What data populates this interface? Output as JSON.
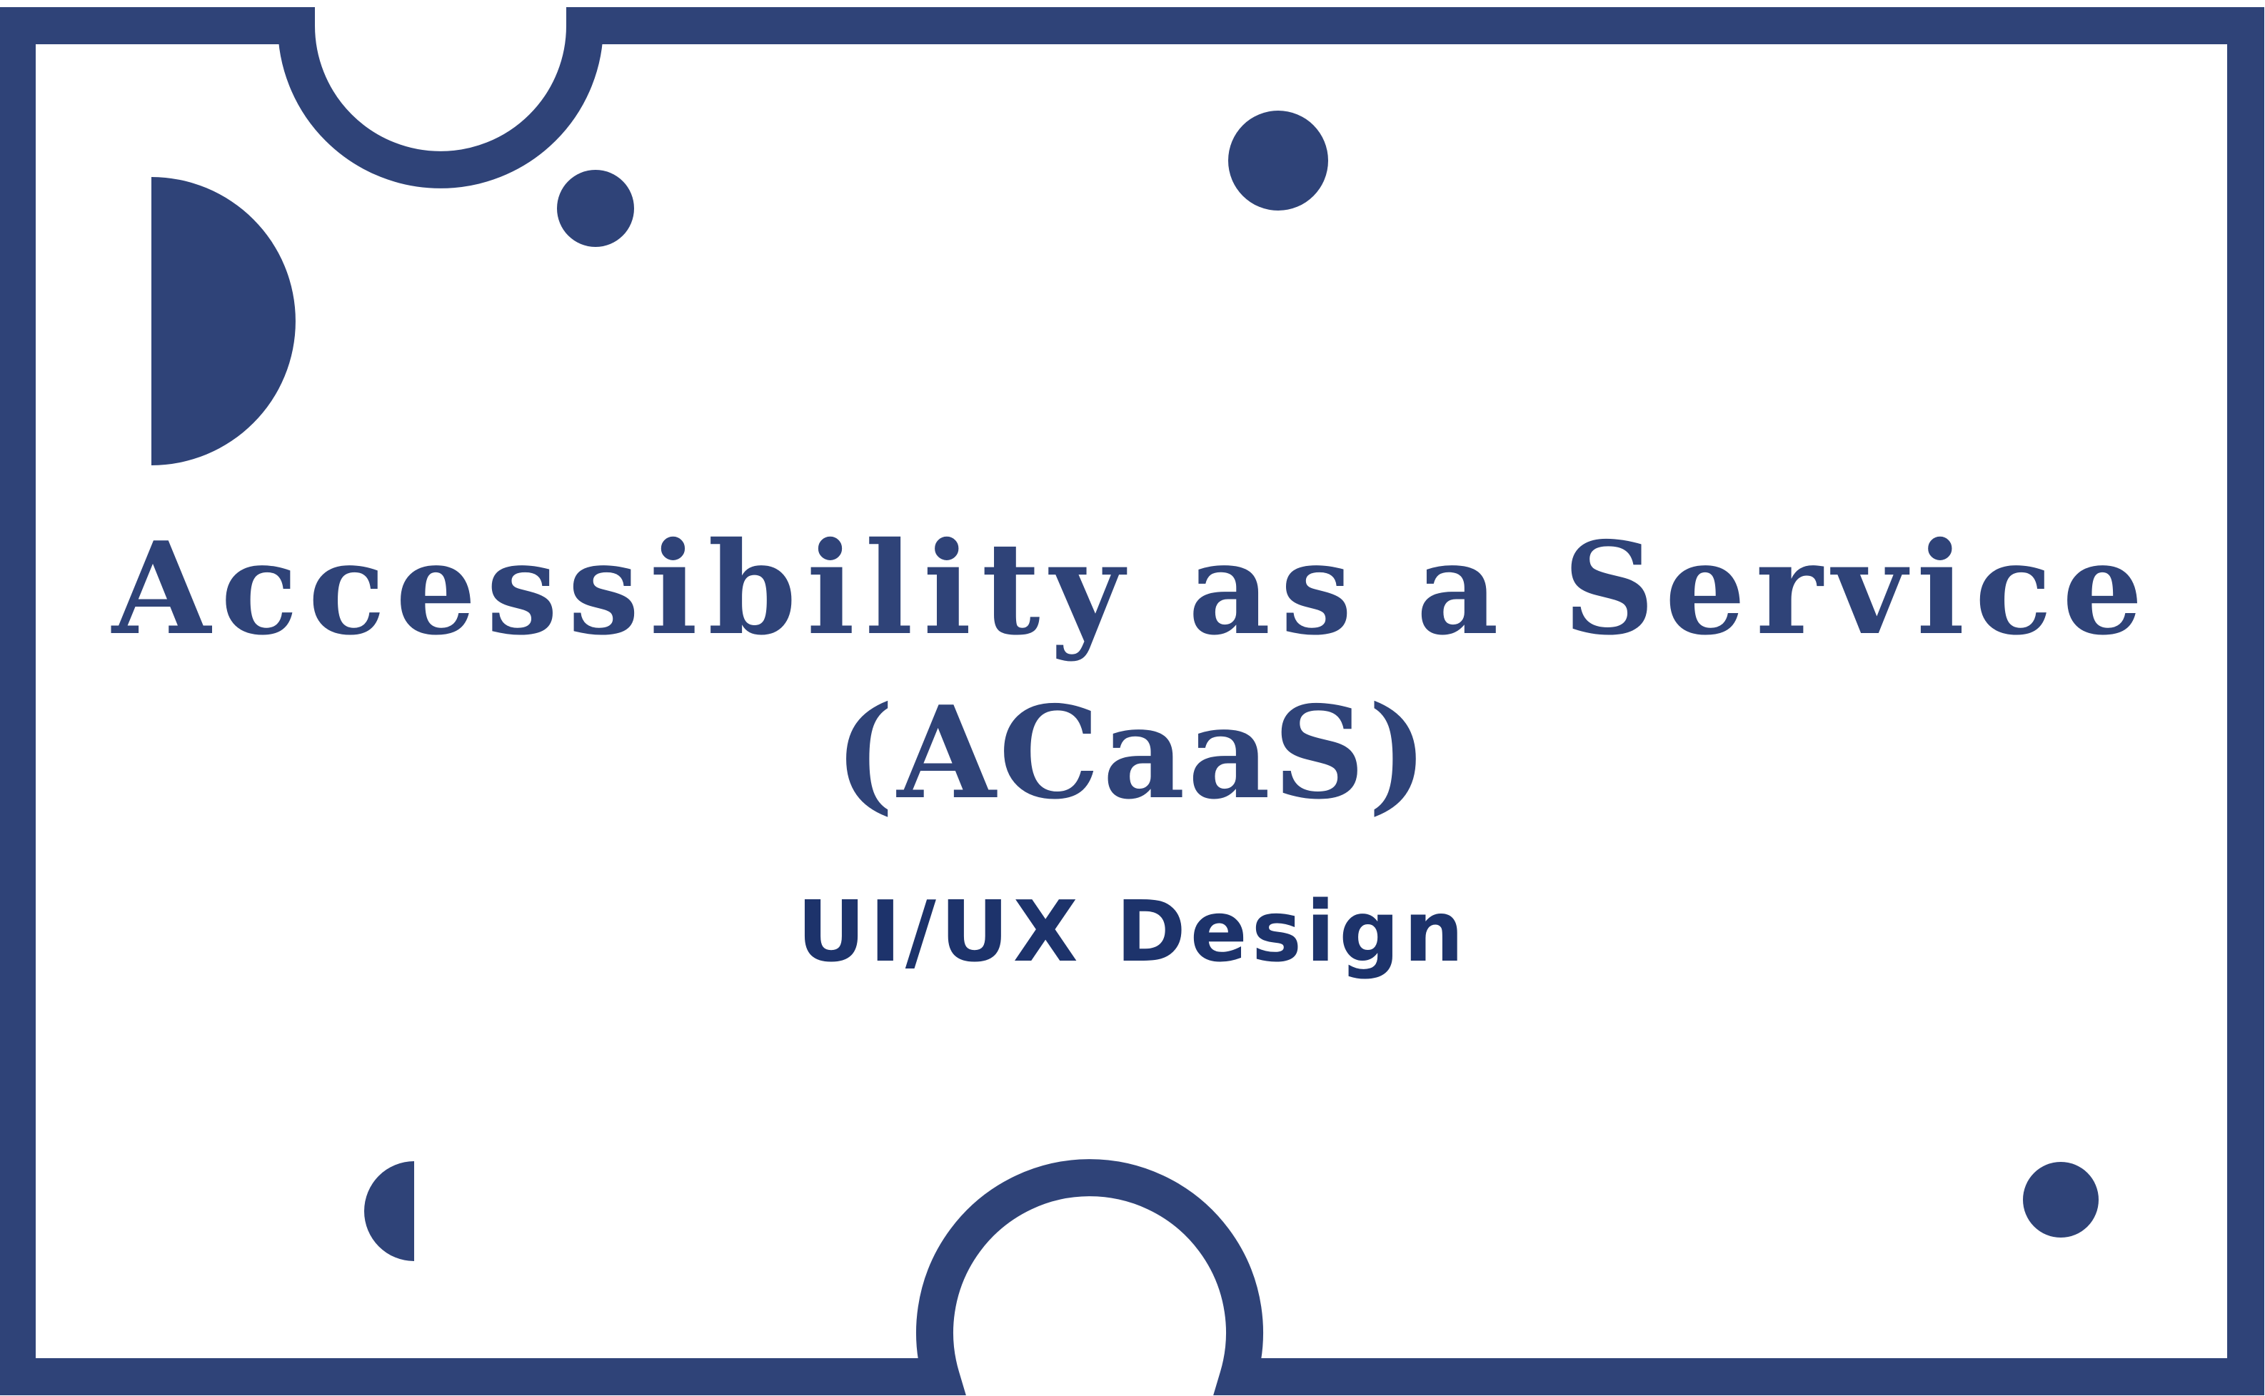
{
  "colors": {
    "accent": "#2f4378",
    "subtitle": "#1d336b",
    "background": "#ffffff"
  },
  "slide": {
    "title_line_1": "Accessibility as a Service",
    "title_line_2": "(ACaaS)",
    "subtitle": "UI/UX Design"
  }
}
